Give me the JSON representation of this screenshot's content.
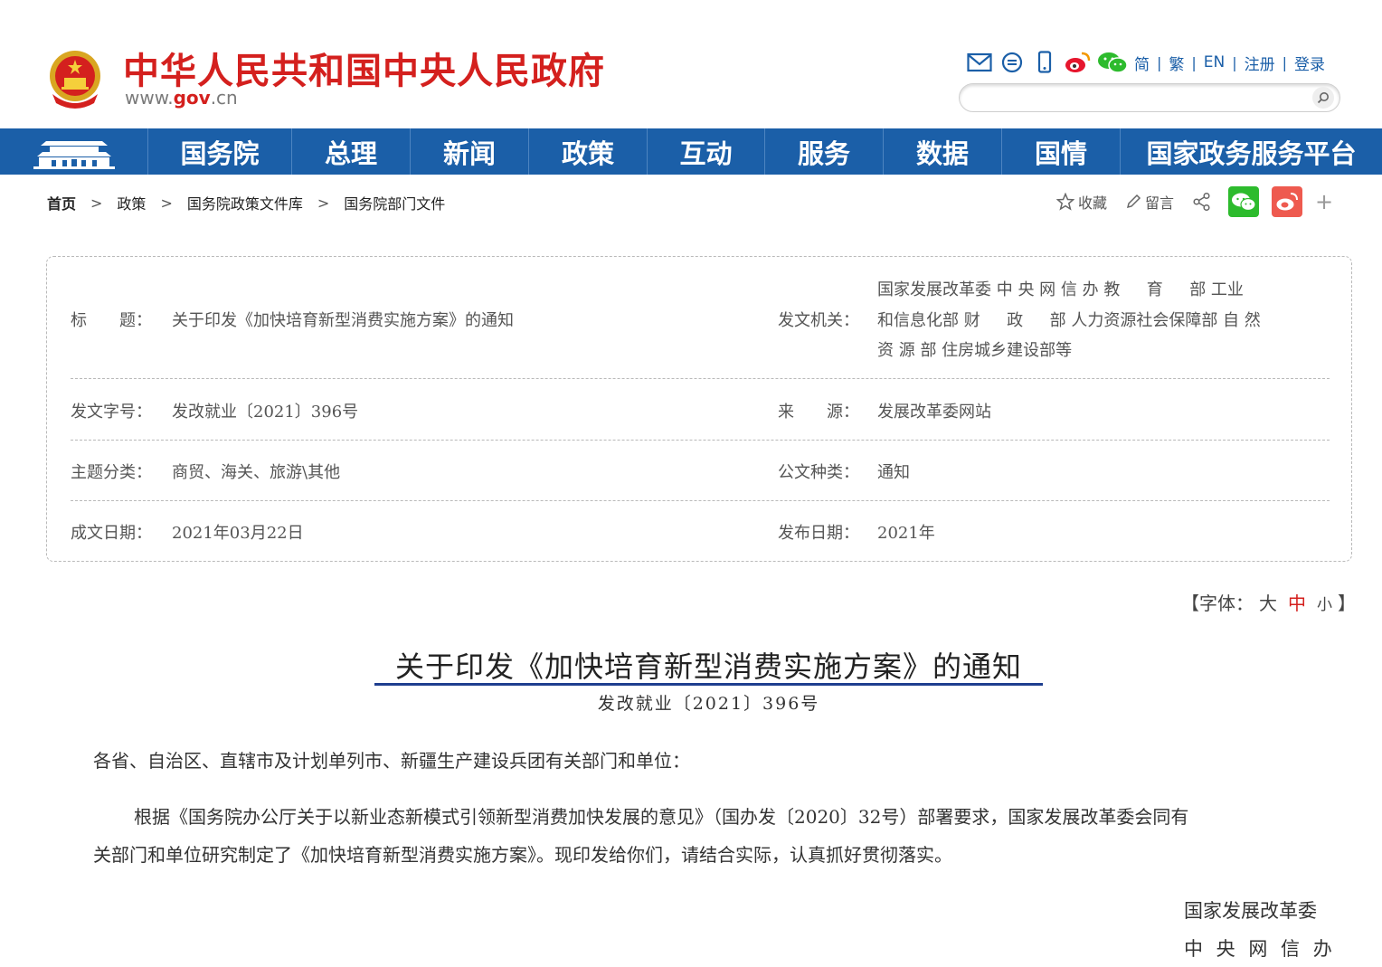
{
  "header": {
    "site_title": "中华人民共和国中央人民政府",
    "url_prefix": "www.",
    "url_gov": "gov",
    "url_suffix": ".cn",
    "icons": [
      "mail-icon",
      "chat-icon",
      "mobile-icon",
      "weibo-icon",
      "wechat-icon"
    ],
    "links": [
      "简",
      "繁",
      "EN",
      "注册",
      "登录"
    ],
    "search_placeholder": ""
  },
  "nav": {
    "items": [
      "国务院",
      "总理",
      "新闻",
      "政策",
      "互动",
      "服务",
      "数据",
      "国情",
      "国家政务服务平台"
    ]
  },
  "breadcrumb": [
    "首页",
    "政策",
    "国务院政策文件库",
    "国务院部门文件"
  ],
  "share": {
    "favorite": "收藏",
    "comment": "留言",
    "plus": "+"
  },
  "info": {
    "title_label": "标　　题：",
    "title_value": "关于印发《加快培育新型消费实施方案》的通知",
    "issuer_label": "发文机关：",
    "issuer_lines": [
      "国家发展改革委 中 央 网 信 办 教 　 育 　 部 工业",
      "和信息化部 财 　 政 　 部 人力资源社会保障部 自 然",
      "资 源 部 住房城乡建设部等"
    ],
    "docno_label": "发文字号：",
    "docno_value": "发改就业〔2021〕396号",
    "source_label": "来　　源：",
    "source_value": "发展改革委网站",
    "topic_label": "主题分类：",
    "topic_value": "商贸、海关、旅游\\其他",
    "type_label": "公文种类：",
    "type_value": "通知",
    "written_label": "成文日期：",
    "written_value": "2021年03月22日",
    "published_label": "发布日期：",
    "published_value": "2021年"
  },
  "font_size": {
    "prefix": "【字体：",
    "large": "大",
    "medium": "中",
    "small": "小",
    "suffix": "】"
  },
  "article": {
    "title": "关于印发《加快培育新型消费实施方案》的通知",
    "doc_number": "发改就业〔2021〕396号",
    "salutation": "各省、自治区、直辖市及计划单列市、新疆生产建设兵团有关部门和单位：",
    "para1_line1": "根据《国务院办公厅关于以新业态新模式引领新型消费加快发展的意见》（国办发〔2020〕32号）部署要求，国家发展改革委会同有",
    "para1_line2": "关部门和单位研究制定了《加快培育新型消费实施方案》。现印发给你们，请结合实际，认真抓好贯彻落实。",
    "signatures": [
      "国家发展改革委",
      "中 央 网 信 办"
    ]
  },
  "colors": {
    "brand_red": "#d4201e",
    "nav_blue": "#1b5fa8",
    "title_underline": "#1f3f8f"
  }
}
